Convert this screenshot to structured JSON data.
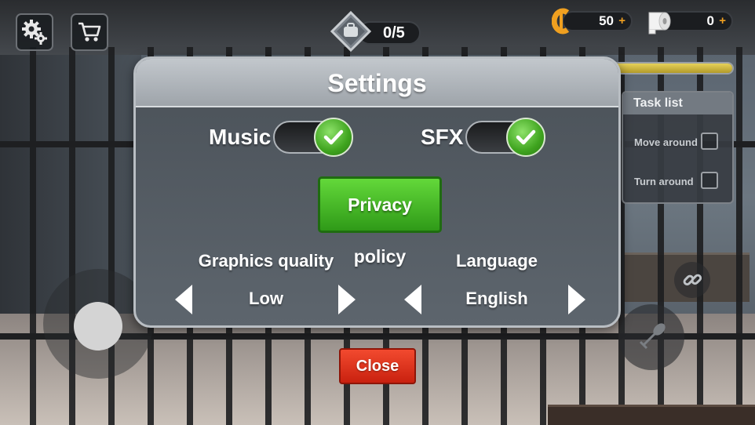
{
  "hud": {
    "settings_icon": "gears-icon",
    "shop_icon": "cart-icon",
    "collectibles_count": "0/5",
    "collectibles_icon": "bag-icon",
    "coins": {
      "value": "50",
      "plus": "+",
      "icon": "coin-icon"
    },
    "toilet_paper": {
      "value": "0",
      "plus": "+",
      "icon": "toilet-paper-icon"
    },
    "progress": 1.0
  },
  "task_list": {
    "title": "Task list",
    "items": [
      {
        "label": "Move around",
        "done": false
      },
      {
        "label": "Turn around",
        "done": false
      }
    ]
  },
  "settings": {
    "title": "Settings",
    "music_label": "Music",
    "music_on": true,
    "sfx_label": "SFX",
    "sfx_on": true,
    "privacy_label": "Privacy policy",
    "graphics_label": "Graphics quality",
    "graphics_value": "Low",
    "language_label": "Language",
    "language_value": "English",
    "close_label": "Close"
  },
  "colors": {
    "accent_green": "#3fa41f",
    "close_red": "#d9301a",
    "progress_yellow": "#d8c24a",
    "coin_orange": "#f0a020"
  }
}
